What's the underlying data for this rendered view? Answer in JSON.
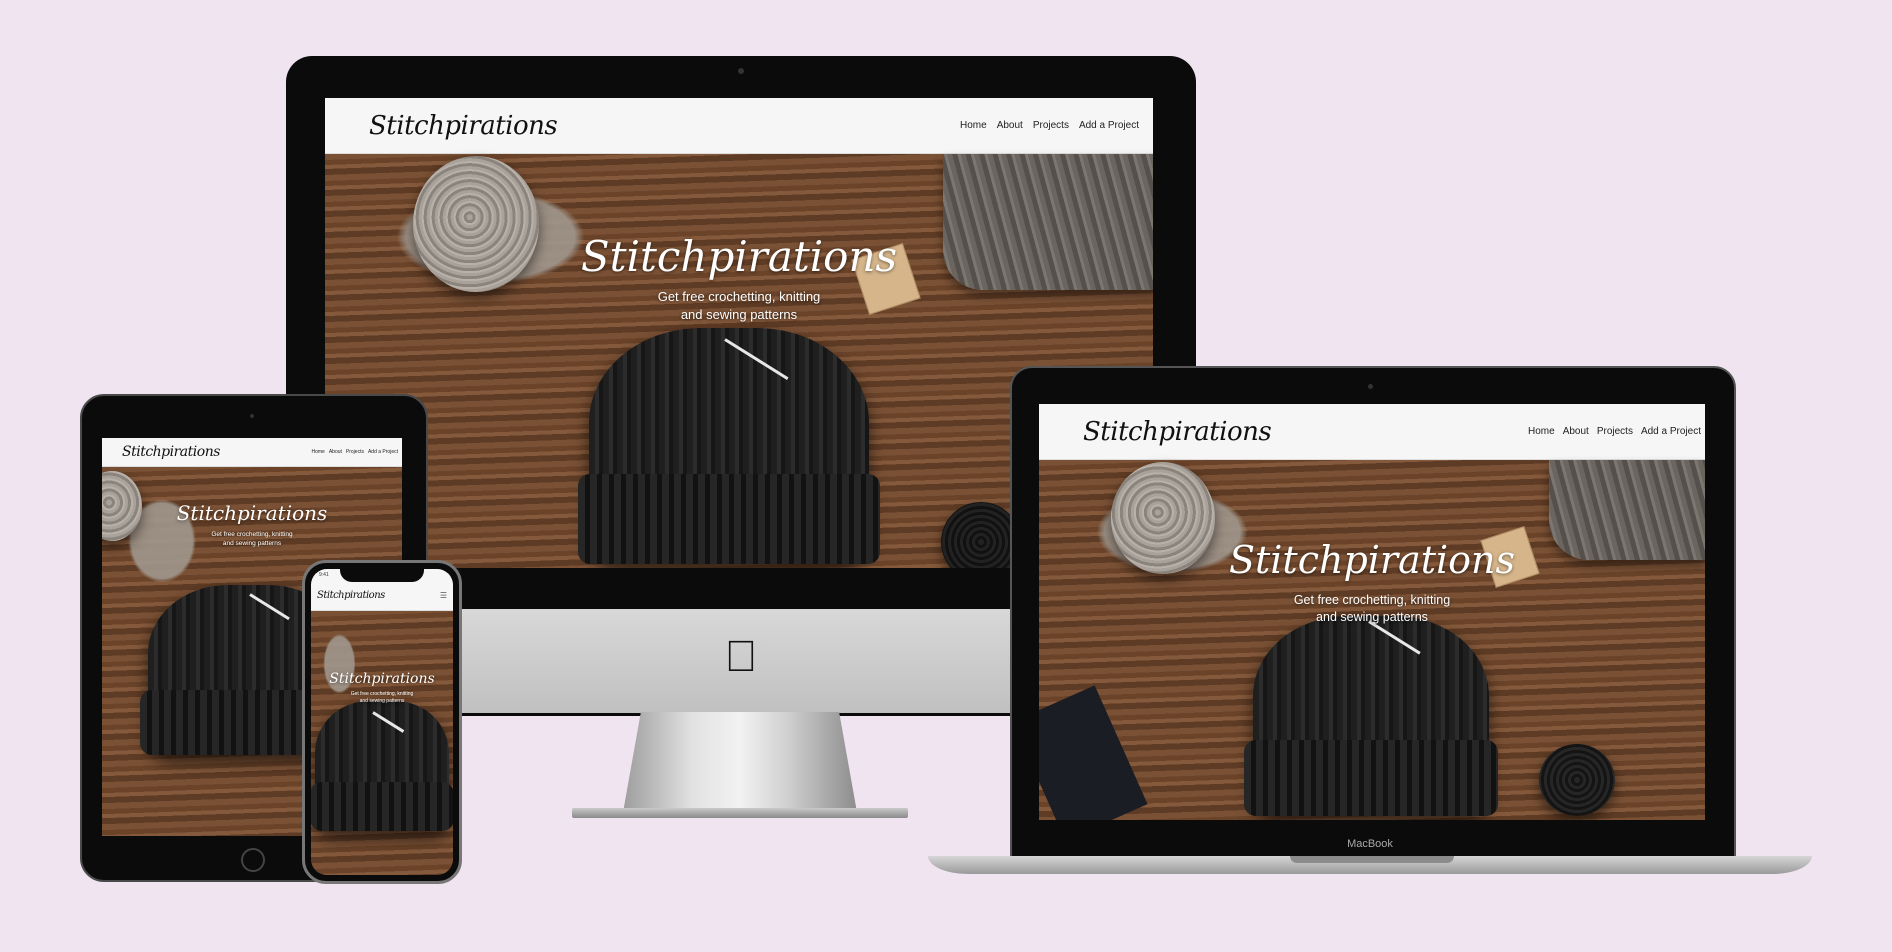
{
  "site": {
    "brand": "Stitchpirations",
    "nav": [
      "Home",
      "About",
      "Projects",
      "Add a Project"
    ],
    "hero_title": "Stitchpirations",
    "hero_subtitle_line1": "Get free crochetting, knitting",
    "hero_subtitle_line2": "and sewing patterns"
  },
  "devices": {
    "laptop_label": "MacBook",
    "phone_time": "9:41"
  },
  "icons": {
    "apple_logo": "apple-logo-icon",
    "hamburger": "hamburger-menu-icon"
  },
  "colors": {
    "background": "#f0e4f0",
    "nav_bar": "#f6f6f6",
    "device_frame": "#0b0b0b"
  }
}
